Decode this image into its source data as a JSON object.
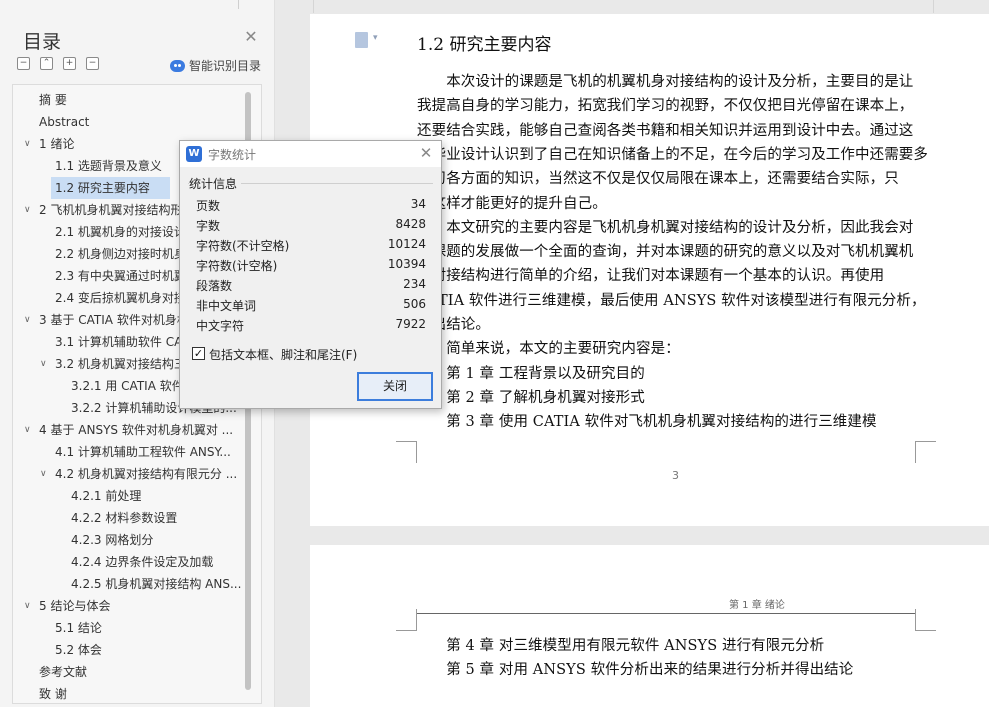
{
  "nav": {
    "title": "目录",
    "smart_label": "智能识别目录",
    "tools": [
      "−",
      "⌃",
      "+",
      "−"
    ],
    "toc": [
      {
        "label": "摘 要",
        "level": 1,
        "chevron": ""
      },
      {
        "label": "Abstract",
        "level": 1,
        "chevron": ""
      },
      {
        "label": "1 绪论",
        "level": 1,
        "chevron": "∨"
      },
      {
        "label": "1.1 选题背景及意义",
        "level": 2,
        "chevron": ""
      },
      {
        "label": "1.2 研究主要内容",
        "level": 2,
        "chevron": "",
        "selected": true
      },
      {
        "label": "2 飞机机身机翼对接结构形",
        "level": 1,
        "chevron": "∨"
      },
      {
        "label": "2.1 机翼机身的对接设计",
        "level": 2,
        "chevron": ""
      },
      {
        "label": "2.2 机身侧边对接时机身",
        "level": 2,
        "chevron": ""
      },
      {
        "label": "2.3 有中央翼通过时机翼",
        "level": 2,
        "chevron": ""
      },
      {
        "label": "2.4 变后掠机翼机身对接",
        "level": 2,
        "chevron": ""
      },
      {
        "label": "3 基于 CATIA 软件对机身机",
        "level": 1,
        "chevron": "∨"
      },
      {
        "label": "3.1 计算机辅助软件 CA",
        "level": 2,
        "chevron": ""
      },
      {
        "label": "3.2 机身机翼对接结构三",
        "level": 2,
        "chevron": "∨"
      },
      {
        "label": "3.2.1 用 CATIA 软件",
        "level": 3,
        "chevron": ""
      },
      {
        "label": "3.2.2 计算机辅助设计模型的...",
        "level": 3,
        "chevron": ""
      },
      {
        "label": "4 基于 ANSYS 软件对机身机翼对 ...",
        "level": 1,
        "chevron": "∨"
      },
      {
        "label": "4.1 计算机辅助工程软件 ANSY...",
        "level": 2,
        "chevron": ""
      },
      {
        "label": "4.2 机身机翼对接结构有限元分 ...",
        "level": 2,
        "chevron": "∨"
      },
      {
        "label": "4.2.1 前处理",
        "level": 3,
        "chevron": ""
      },
      {
        "label": "4.2.2 材料参数设置",
        "level": 3,
        "chevron": ""
      },
      {
        "label": "4.2.3 网格划分",
        "level": 3,
        "chevron": ""
      },
      {
        "label": "4.2.4 边界条件设定及加载",
        "level": 3,
        "chevron": ""
      },
      {
        "label": "4.2.5 机身机翼对接结构 ANS...",
        "level": 3,
        "chevron": ""
      },
      {
        "label": "5 结论与体会",
        "level": 1,
        "chevron": "∨"
      },
      {
        "label": "5.1 结论",
        "level": 2,
        "chevron": ""
      },
      {
        "label": "5.2 体会",
        "level": 2,
        "chevron": ""
      },
      {
        "label": "参考文献",
        "level": 1,
        "chevron": ""
      },
      {
        "label": "致 谢",
        "level": 1,
        "chevron": ""
      }
    ]
  },
  "document": {
    "heading": "1.2 研究主要内容",
    "page1_lines": [
      "　　本次设计的课题是飞机的机翼机身对接结构的设计及分析，主要目的是让",
      "我提高自身的学习能力，拓宽我们学习的视野，不仅仅把目光停留在课本上，",
      "还要结合实践，能够自己查阅各类书籍和相关知识并运用到设计中去。通过这",
      "次毕业设计认识到了自己在知识储备上的不足，在今后的学习及工作中还需要多",
      "学习各方面的知识，当然这不仅是仅仅局限在课本上，还需要结合实际，只",
      "有这样才能更好的提升自己。",
      "　　本文研究的主要内容是飞机机身机翼对接结构的设计及分析，因此我会对",
      "本课题的发展做一个全面的查询，并对本课题的研究的意义以及对飞机机翼机",
      "身对接结构进行简单的介绍，让我们对本课题有一个基本的认识。再使用",
      "CATIA 软件进行三维建模，最后使用 ANSYS 软件对该模型进行有限元分析，",
      "得出结论。",
      "　　简单来说，本文的主要研究内容是：",
      "　　第 1 章 工程背景以及研究目的",
      "　　第 2 章 了解机身机翼对接形式",
      "　　第 3 章 使用 CATIA 软件对飞机机身机翼对接结构的进行三维建模"
    ],
    "page_number": "3",
    "page2_header": "第 1 章 绪论",
    "page2_lines": [
      "　　第 4 章 对三维模型用有限元软件 ANSYS 进行有限元分析",
      "　　第 5 章 对用 ANSYS 软件分析出来的结果进行分析并得出结论"
    ]
  },
  "dialog": {
    "title": "字数统计",
    "logo": "W",
    "group_label": "统计信息",
    "stats": [
      {
        "label": "页数",
        "value": "34"
      },
      {
        "label": "字数",
        "value": "8428"
      },
      {
        "label": "字符数(不计空格)",
        "value": "10124"
      },
      {
        "label": "字符数(计空格)",
        "value": "10394"
      },
      {
        "label": "段落数",
        "value": "234"
      },
      {
        "label": "非中文单词",
        "value": "506"
      },
      {
        "label": "中文字符",
        "value": "7922"
      }
    ],
    "checkbox_label": "包括文本框、脚注和尾注(F)",
    "checkbox_checked": true,
    "close_button": "关闭"
  }
}
